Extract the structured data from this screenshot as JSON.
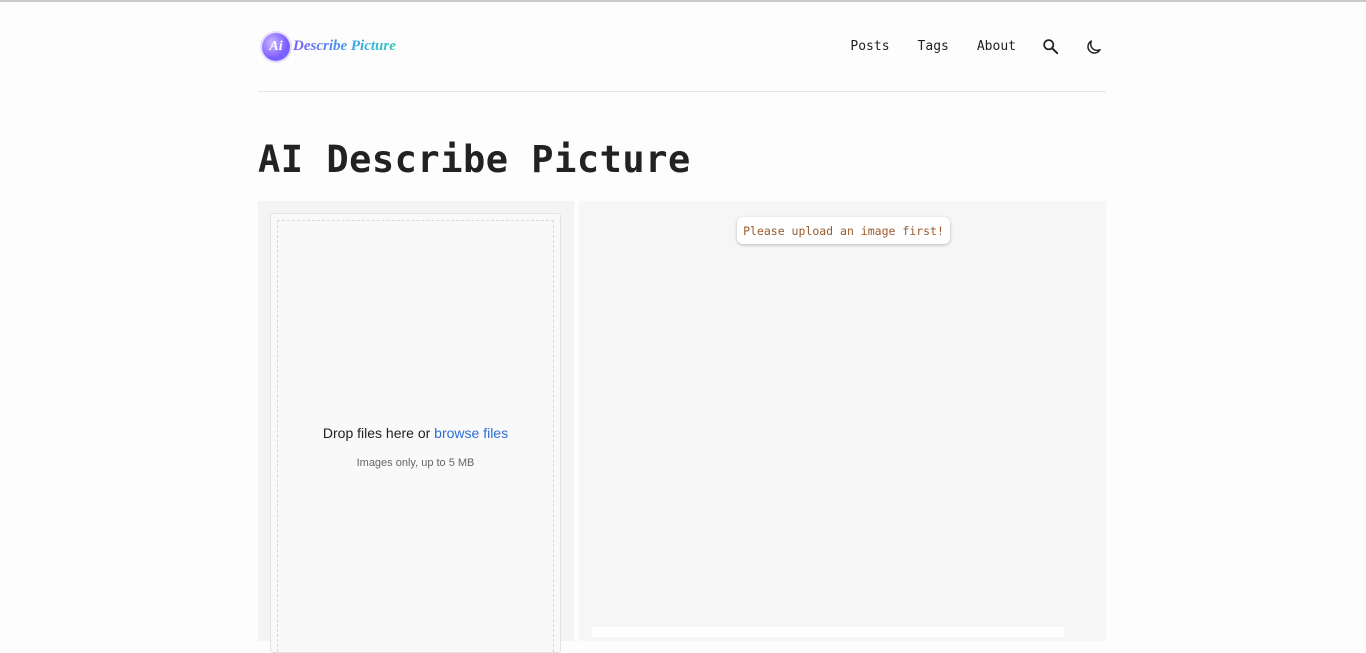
{
  "logo": {
    "badge": "Ai",
    "text": "Describe Picture"
  },
  "nav": {
    "items": [
      "Posts",
      "Tags",
      "About"
    ],
    "search_icon": "search-icon",
    "theme_icon": "moon-icon"
  },
  "page": {
    "title": "AI Describe Picture"
  },
  "uploader": {
    "drop_prefix": "Drop files here or ",
    "browse_label": "browse files",
    "hint": "Images only, up to 5 MB"
  },
  "result": {
    "toast": "Please upload an image first!"
  },
  "colors": {
    "link": "#2a6fd6",
    "toast_text": "#9a5a2b",
    "panel_bg": "#f6f6f7"
  }
}
